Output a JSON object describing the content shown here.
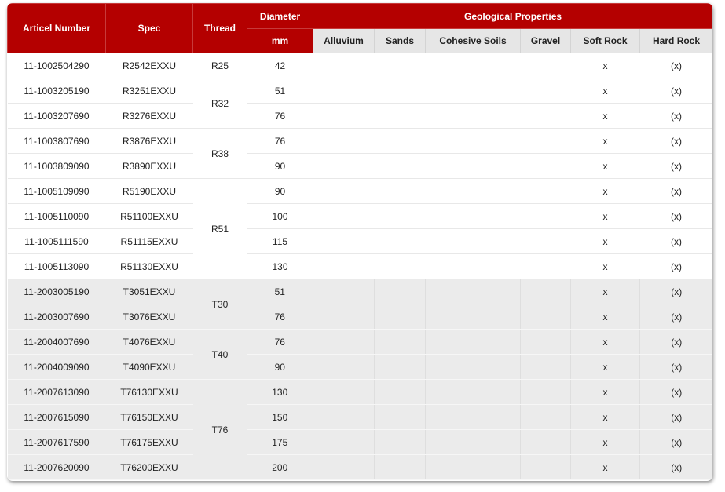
{
  "headers": {
    "article_number": "Articel Number",
    "spec": "Spec",
    "thread": "Thread",
    "diameter": "Diameter",
    "diameter_unit": "mm",
    "geological_properties": "Geological Properties",
    "geo": [
      "Alluvium",
      "Sands",
      "Cohesive Soils",
      "Gravel",
      "Soft Rock",
      "Hard Rock"
    ]
  },
  "colors": {
    "header_red": "#b40000",
    "subheader_gray": "#e6e6e6",
    "group_t_background": "#ebebeb"
  },
  "rows": [
    {
      "article": "11-1002504290",
      "spec": "R2542EXXU",
      "diameter": "42",
      "geo": [
        "",
        "",
        "",
        "",
        "x",
        "(x)"
      ]
    },
    {
      "article": "11-1003205190",
      "spec": "R3251EXXU",
      "diameter": "51",
      "geo": [
        "",
        "",
        "",
        "",
        "x",
        "(x)"
      ]
    },
    {
      "article": "11-1003207690",
      "spec": "R3276EXXU",
      "diameter": "76",
      "geo": [
        "",
        "",
        "",
        "",
        "x",
        "(x)"
      ]
    },
    {
      "article": "11-1003807690",
      "spec": "R3876EXXU",
      "diameter": "76",
      "geo": [
        "",
        "",
        "",
        "",
        "x",
        "(x)"
      ]
    },
    {
      "article": "11-1003809090",
      "spec": "R3890EXXU",
      "diameter": "90",
      "geo": [
        "",
        "",
        "",
        "",
        "x",
        "(x)"
      ]
    },
    {
      "article": "11-1005109090",
      "spec": "R5190EXXU",
      "diameter": "90",
      "geo": [
        "",
        "",
        "",
        "",
        "x",
        "(x)"
      ]
    },
    {
      "article": "11-1005110090",
      "spec": "R51100EXXU",
      "diameter": "100",
      "geo": [
        "",
        "",
        "",
        "",
        "x",
        "(x)"
      ]
    },
    {
      "article": "11-1005111590",
      "spec": "R51115EXXU",
      "diameter": "115",
      "geo": [
        "",
        "",
        "",
        "",
        "x",
        "(x)"
      ]
    },
    {
      "article": "11-1005113090",
      "spec": "R51130EXXU",
      "diameter": "130",
      "geo": [
        "",
        "",
        "",
        "",
        "x",
        "(x)"
      ]
    },
    {
      "article": "11-2003005190",
      "spec": "T3051EXXU",
      "diameter": "51",
      "geo": [
        "",
        "",
        "",
        "",
        "x",
        "(x)"
      ]
    },
    {
      "article": "11-2003007690",
      "spec": "T3076EXXU",
      "diameter": "76",
      "geo": [
        "",
        "",
        "",
        "",
        "x",
        "(x)"
      ]
    },
    {
      "article": "11-2004007690",
      "spec": "T4076EXXU",
      "diameter": "76",
      "geo": [
        "",
        "",
        "",
        "",
        "x",
        "(x)"
      ]
    },
    {
      "article": "11-2004009090",
      "spec": "T4090EXXU",
      "diameter": "90",
      "geo": [
        "",
        "",
        "",
        "",
        "x",
        "(x)"
      ]
    },
    {
      "article": "11-2007613090",
      "spec": "T76130EXXU",
      "diameter": "130",
      "geo": [
        "",
        "",
        "",
        "",
        "x",
        "(x)"
      ]
    },
    {
      "article": "11-2007615090",
      "spec": "T76150EXXU",
      "diameter": "150",
      "geo": [
        "",
        "",
        "",
        "",
        "x",
        "(x)"
      ]
    },
    {
      "article": "11-2007617590",
      "spec": "T76175EXXU",
      "diameter": "175",
      "geo": [
        "",
        "",
        "",
        "",
        "x",
        "(x)"
      ]
    },
    {
      "article": "11-2007620090",
      "spec": "T76200EXXU",
      "diameter": "200",
      "geo": [
        "",
        "",
        "",
        "",
        "x",
        "(x)"
      ]
    }
  ],
  "threads": [
    {
      "label": "R25",
      "rowspan": 1
    },
    {
      "label": "R32",
      "rowspan": 2
    },
    {
      "label": "R38",
      "rowspan": 2
    },
    {
      "label": "R51",
      "rowspan": 4
    },
    {
      "label": "T30",
      "rowspan": 2
    },
    {
      "label": "T40",
      "rowspan": 2
    },
    {
      "label": "T76",
      "rowspan": 4
    }
  ]
}
